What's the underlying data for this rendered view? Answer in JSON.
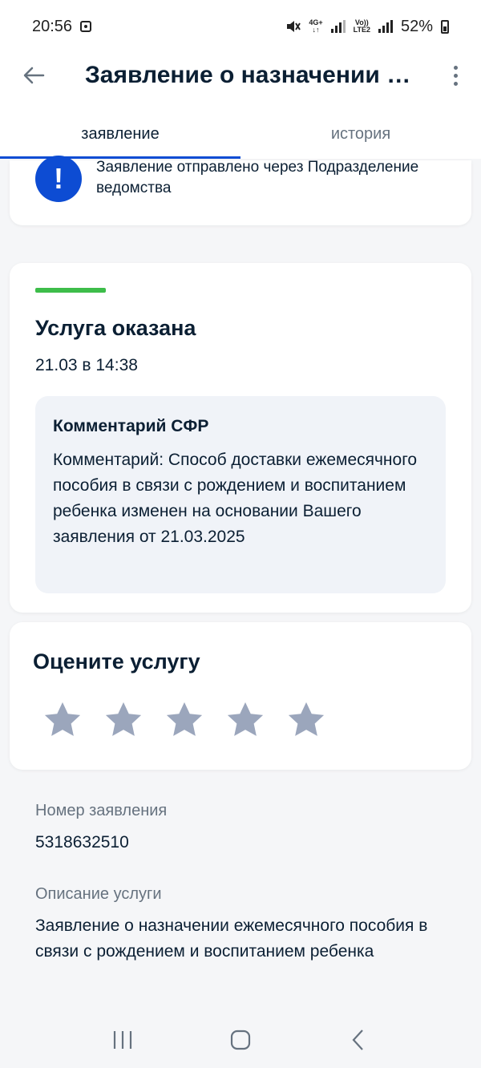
{
  "status_bar": {
    "time": "20:56",
    "net_top": "4G+",
    "net_volte_top": "Vo))",
    "net_volte_bottom": "LTE2",
    "battery": "52%"
  },
  "header": {
    "title": "Заявление о назначении ежемесячного пособия в связи с рождением и воспитанием ребенка",
    "tabs": [
      "заявление",
      "история"
    ]
  },
  "info_card": {
    "text": "Заявление отправлено через Подразделение ведомства",
    "icon_symbol": "!"
  },
  "status_card": {
    "title": "Услуга оказана",
    "date": "21.03 в 14:38",
    "comment_title": "Комментарий СФР",
    "comment_text": "Комментарий: Способ доставки ежемесячного пособия в связи с рождением и воспитанием ребенка изменен на основании Вашего заявления от 21.03.2025",
    "status_color": "#3dbd4a"
  },
  "rating": {
    "title": "Оцените услугу",
    "stars": 5,
    "selected": 0,
    "star_color": "#9ba6bc"
  },
  "details": {
    "number_label": "Номер заявления",
    "number_value": "5318632510",
    "description_label": "Описание услуги",
    "description_value": "Заявление о назначении ежемесячного пособия в связи с рождением и воспитанием ребенка"
  },
  "colors": {
    "accent": "#0d4cd3",
    "text": "#0b1f33",
    "muted": "#66727f",
    "background": "#f5f6f8"
  }
}
